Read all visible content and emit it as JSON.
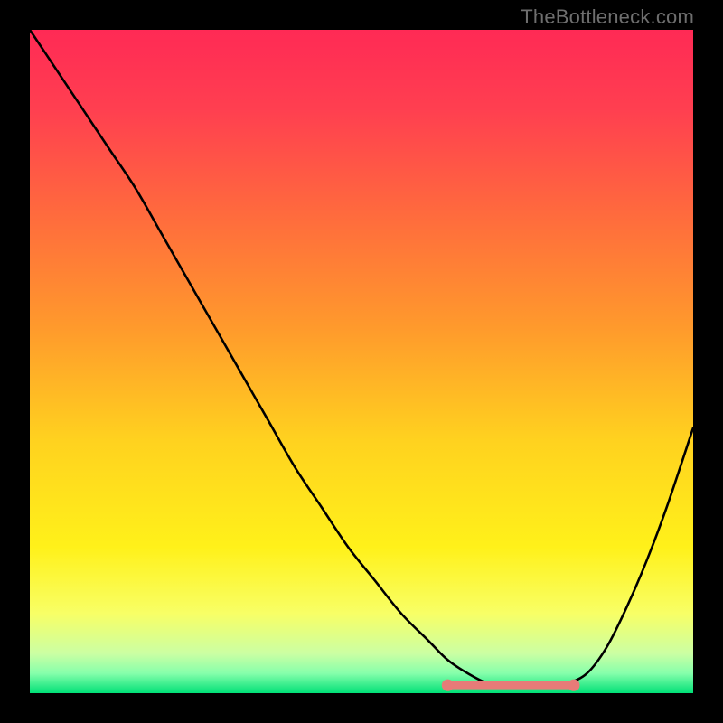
{
  "watermark": "TheBottleneck.com",
  "chart_data": {
    "type": "line",
    "title": "",
    "xlabel": "",
    "ylabel": "",
    "xlim": [
      0,
      100
    ],
    "ylim": [
      0,
      100
    ],
    "gradient_stops": [
      {
        "offset": 0.0,
        "color": "#ff2a55"
      },
      {
        "offset": 0.12,
        "color": "#ff3f50"
      },
      {
        "offset": 0.28,
        "color": "#ff6b3d"
      },
      {
        "offset": 0.45,
        "color": "#ff9a2c"
      },
      {
        "offset": 0.62,
        "color": "#ffd21f"
      },
      {
        "offset": 0.78,
        "color": "#fff11a"
      },
      {
        "offset": 0.88,
        "color": "#f8ff66"
      },
      {
        "offset": 0.94,
        "color": "#ccffa3"
      },
      {
        "offset": 0.97,
        "color": "#86ffab"
      },
      {
        "offset": 1.0,
        "color": "#00e077"
      }
    ],
    "series": [
      {
        "name": "bottleneck-curve",
        "x": [
          0,
          4,
          8,
          12,
          16,
          20,
          24,
          28,
          32,
          36,
          40,
          44,
          48,
          52,
          56,
          60,
          63,
          66,
          69,
          72,
          75,
          78,
          81,
          84,
          87,
          90,
          93,
          96,
          100
        ],
        "values": [
          100,
          94,
          88,
          82,
          76,
          69,
          62,
          55,
          48,
          41,
          34,
          28,
          22,
          17,
          12,
          8,
          5,
          3,
          1.5,
          1,
          1,
          1,
          1.5,
          3,
          7,
          13,
          20,
          28,
          40
        ]
      }
    ],
    "flat_region": {
      "name": "optimal-zone",
      "color": "#e77b78",
      "x_start": 63,
      "x_end": 82,
      "y": 1.2,
      "endpoint_radius": 0.9
    }
  }
}
